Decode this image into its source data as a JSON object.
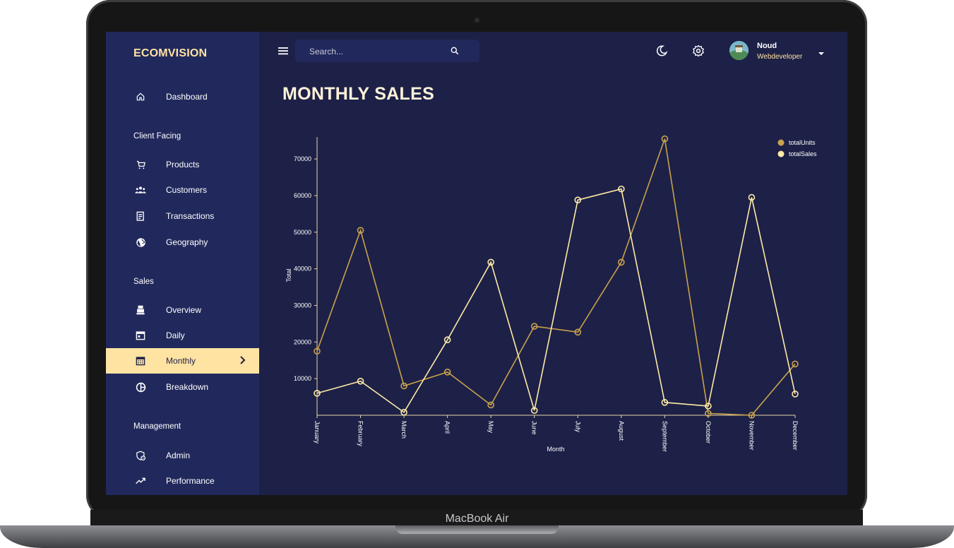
{
  "device": {
    "label": "MacBook Air"
  },
  "app": {
    "name": "ECOMVISION"
  },
  "sidebar": {
    "items": [
      {
        "label": "Dashboard",
        "icon": "home-icon"
      },
      {
        "label": "Client Facing",
        "section": true
      },
      {
        "label": "Products",
        "icon": "cart-icon"
      },
      {
        "label": "Customers",
        "icon": "groups-icon"
      },
      {
        "label": "Transactions",
        "icon": "receipt-icon"
      },
      {
        "label": "Geography",
        "icon": "globe-icon"
      },
      {
        "label": "Sales",
        "section": true
      },
      {
        "label": "Overview",
        "icon": "point-of-sale-icon"
      },
      {
        "label": "Daily",
        "icon": "calendar-today-icon"
      },
      {
        "label": "Monthly",
        "icon": "calendar-month-icon",
        "active": true
      },
      {
        "label": "Breakdown",
        "icon": "pie-chart-icon"
      },
      {
        "label": "Management",
        "section": true
      },
      {
        "label": "Admin",
        "icon": "admin-icon"
      },
      {
        "label": "Performance",
        "icon": "trending-up-icon"
      }
    ]
  },
  "topbar": {
    "search_placeholder": "Search...",
    "user_name": "Noud",
    "user_role": "Webdeveloper"
  },
  "page": {
    "title": "MONTHLY SALES"
  },
  "colors": {
    "background": "#1d2147",
    "sidebar": "#21295c",
    "accent": "#ffe3a3",
    "totalUnits": "#c9a24c",
    "totalSales": "#ffeaa8"
  },
  "chart_data": {
    "type": "line",
    "xlabel": "Month",
    "ylabel": "Total",
    "x": [
      "January",
      "February",
      "March",
      "April",
      "May",
      "June",
      "July",
      "August",
      "September",
      "October",
      "November",
      "December"
    ],
    "yticks": [
      10000,
      20000,
      30000,
      40000,
      50000,
      60000,
      70000
    ],
    "ylim": [
      0,
      76000
    ],
    "legend_position": "top-right",
    "grid": false,
    "series": [
      {
        "name": "totalUnits",
        "values": [
          17500,
          50500,
          8000,
          11800,
          2800,
          24300,
          22700,
          41800,
          75500,
          500,
          0,
          14000
        ]
      },
      {
        "name": "totalSales",
        "values": [
          6000,
          9300,
          800,
          20600,
          41800,
          1300,
          58800,
          61800,
          3500,
          2500,
          59500,
          5800
        ]
      }
    ]
  }
}
